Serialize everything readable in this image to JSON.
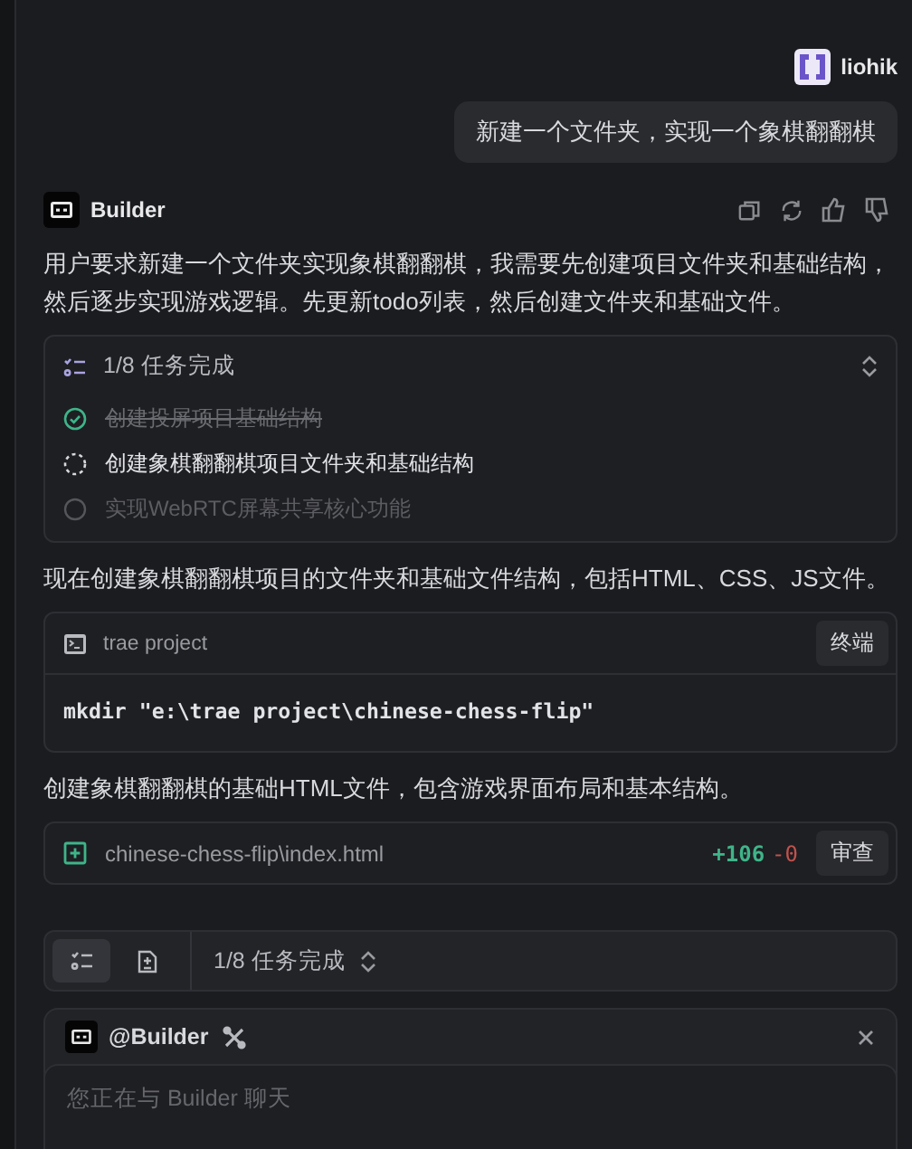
{
  "user": {
    "name": "liohik",
    "message": "新建一个文件夹，实现一个象棋翻翻棋"
  },
  "assistant": {
    "name": "Builder",
    "blocks": [
      {
        "kind": "text",
        "text": "用户要求新建一个文件夹实现象棋翻翻棋，我需要先创建项目文件夹和基础结构，然后逐步实现游戏逻辑。先更新todo列表，然后创建文件夹和基础文件。"
      },
      {
        "kind": "todo",
        "summary": "1/8 任务完成",
        "items": [
          {
            "text": "创建投屏项目基础结构",
            "completed": true,
            "active": false
          },
          {
            "text": "创建象棋翻翻棋项目文件夹和基础结构",
            "completed": false,
            "active": true
          },
          {
            "text": "实现WebRTC屏幕共享核心功能",
            "completed": false,
            "active": false
          }
        ]
      },
      {
        "kind": "text",
        "text": "现在创建象棋翻翻棋项目的文件夹和基础文件结构，包括HTML、CSS、JS文件。"
      },
      {
        "kind": "terminal",
        "cwd": "trae project",
        "button": "终端",
        "command": "mkdir \"e:\\trae project\\chinese-chess-flip\""
      },
      {
        "kind": "text",
        "text": "创建象棋翻翻棋的基础HTML文件，包含游戏界面布局和基本结构。"
      },
      {
        "kind": "file",
        "path": "chinese-chess-flip\\index.html",
        "added": "+106",
        "removed": "-0",
        "button": "审查"
      }
    ]
  },
  "task_bar": {
    "tabs": [
      {
        "kind": "tasks",
        "selected": true
      },
      {
        "kind": "document",
        "selected": false
      }
    ],
    "summary": "1/8 任务完成"
  },
  "composer": {
    "agent": "@Builder",
    "placeholder": "您正在与 Builder 聊天"
  }
}
